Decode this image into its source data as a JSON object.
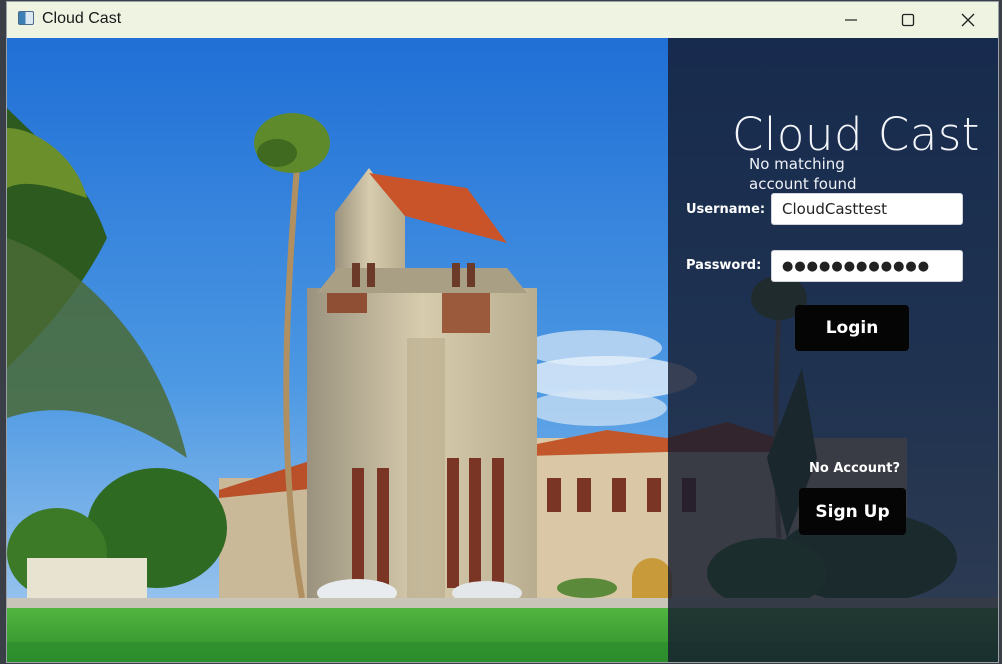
{
  "window": {
    "title": "Cloud Cast",
    "controls": {
      "minimize": "minimize-icon",
      "maximize": "maximize-icon",
      "close": "close-icon"
    }
  },
  "login": {
    "app_title": "Cloud Cast",
    "error_message": "No matching account found",
    "username_label": "Username:",
    "username_value": "CloudCasttest",
    "password_label": "Password:",
    "password_value": "●●●●●●●●●●●●",
    "login_button": "Login",
    "no_account_text": "No Account?",
    "signup_button": "Sign Up"
  },
  "colors": {
    "titlebar": "#eef3e2",
    "panel_overlay": "#161c30",
    "button": "#050505",
    "sky": "#2f7fd9",
    "grass": "#3fa63a"
  }
}
